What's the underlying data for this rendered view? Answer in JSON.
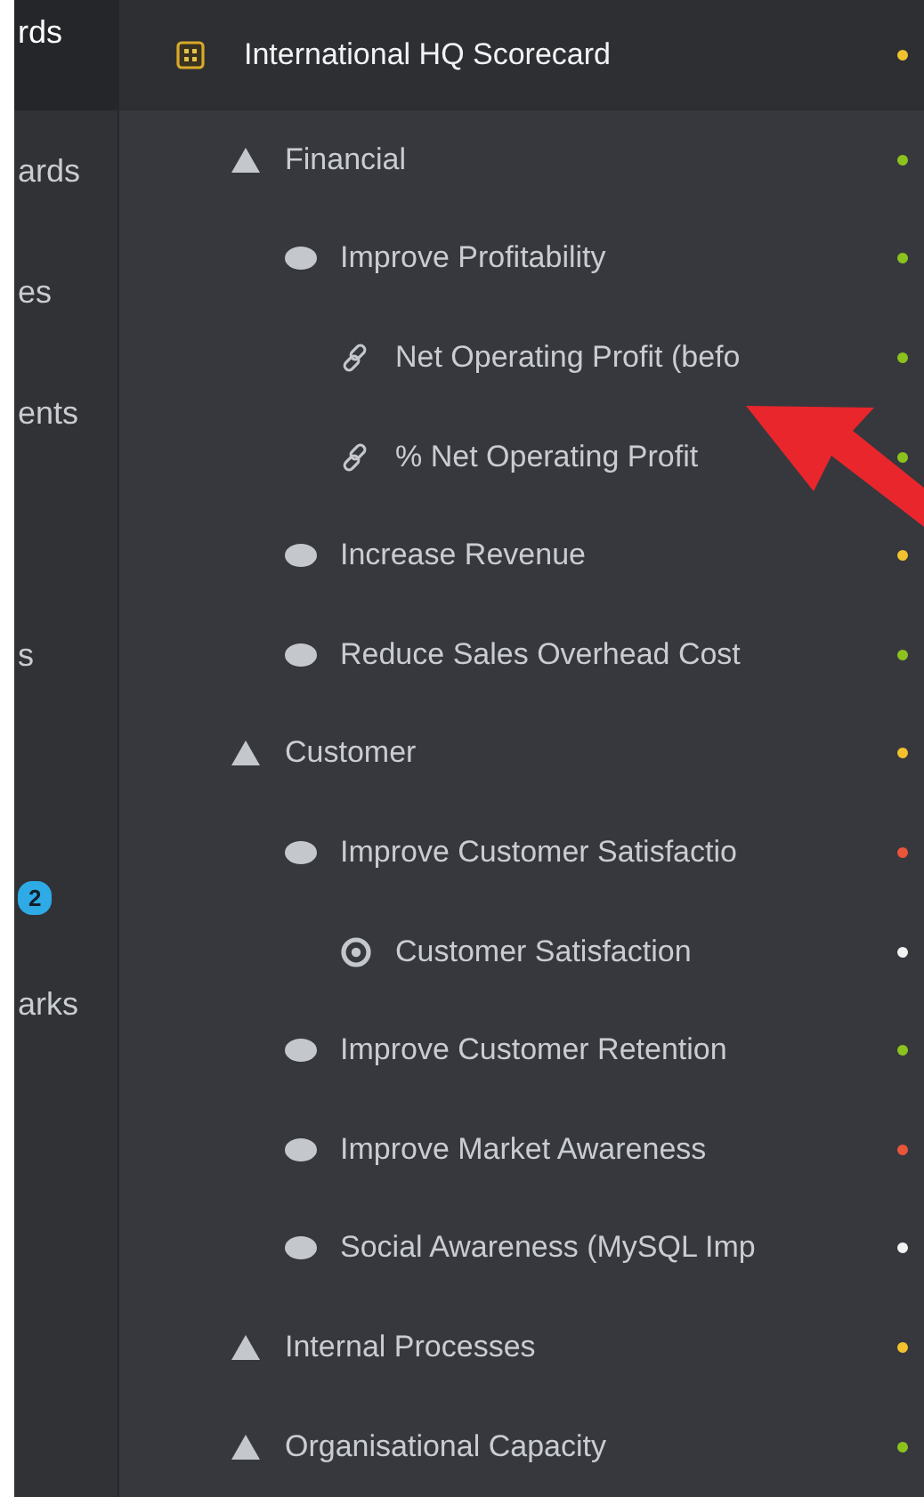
{
  "sidebar": {
    "items": [
      {
        "label": "rds",
        "selected": true
      },
      {
        "label": "ards",
        "selected": false
      },
      {
        "label": "es",
        "selected": false
      },
      {
        "label": "ents",
        "selected": false
      },
      {
        "label": "s",
        "selected": false
      },
      {
        "badge": "2",
        "selected": false
      },
      {
        "label": "arks",
        "selected": false
      }
    ]
  },
  "scorecard": {
    "title": "International HQ Scorecard",
    "color": "#f2c12e",
    "children": [
      {
        "kind": "perspective",
        "label": "Financial",
        "color": "#8cc21e",
        "children": [
          {
            "kind": "objective",
            "label": "Improve Profitability",
            "color": "#8cc21e",
            "children": [
              {
                "kind": "link",
                "label": "Net Operating Profit (befo",
                "color": "#8cc21e"
              },
              {
                "kind": "link",
                "label": "% Net Operating Profit",
                "color": "#8cc21e"
              }
            ]
          },
          {
            "kind": "objective",
            "label": "Increase Revenue",
            "color": "#f2c12e"
          },
          {
            "kind": "objective",
            "label": "Reduce Sales Overhead Cost",
            "color": "#8cc21e"
          }
        ]
      },
      {
        "kind": "perspective",
        "label": "Customer",
        "color": "#f2c12e",
        "children": [
          {
            "kind": "objective",
            "label": "Improve Customer Satisfactio",
            "color": "#e8553a",
            "children": [
              {
                "kind": "target",
                "label": "Customer Satisfaction",
                "color": "#f2f2f2"
              }
            ]
          },
          {
            "kind": "objective",
            "label": "Improve Customer Retention",
            "color": "#8cc21e"
          },
          {
            "kind": "objective",
            "label": "Improve Market Awareness",
            "color": "#e8553a"
          },
          {
            "kind": "objective",
            "label": "Social Awareness (MySQL Imp",
            "color": "#f2f2f2"
          }
        ]
      },
      {
        "kind": "perspective",
        "label": "Internal Processes",
        "color": "#f2c12e"
      },
      {
        "kind": "perspective",
        "label": "Organisational Capacity",
        "color": "#8cc21e"
      }
    ]
  }
}
